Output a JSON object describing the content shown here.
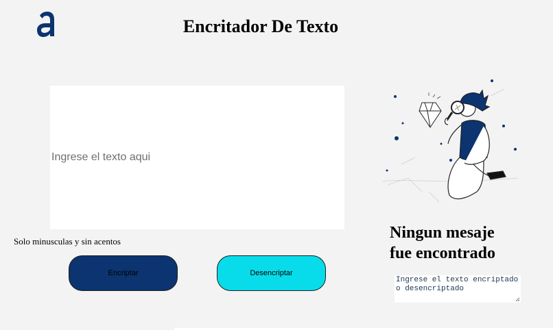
{
  "header": {
    "logo_icon": "brand-a-logo-icon",
    "logo_color": "#0b3470",
    "title": "Encritador De Texto"
  },
  "editor": {
    "placeholder": "Ingrese el texto aqui",
    "value": "",
    "hint": "Solo minusculas y sin acentos"
  },
  "actions": {
    "encrypt_label": "Encriptar",
    "encrypt_color": "#0b3470",
    "decrypt_label": "Desencriptar",
    "decrypt_color": "#08dcea"
  },
  "result": {
    "illustration": "person-with-magnifying-glass-looking-at-diamond",
    "title_line1": "Ningun mesaje",
    "title_line2": "fue encontrado",
    "output_placeholder": "Ingrese el texto encriptado o desencriptado"
  }
}
